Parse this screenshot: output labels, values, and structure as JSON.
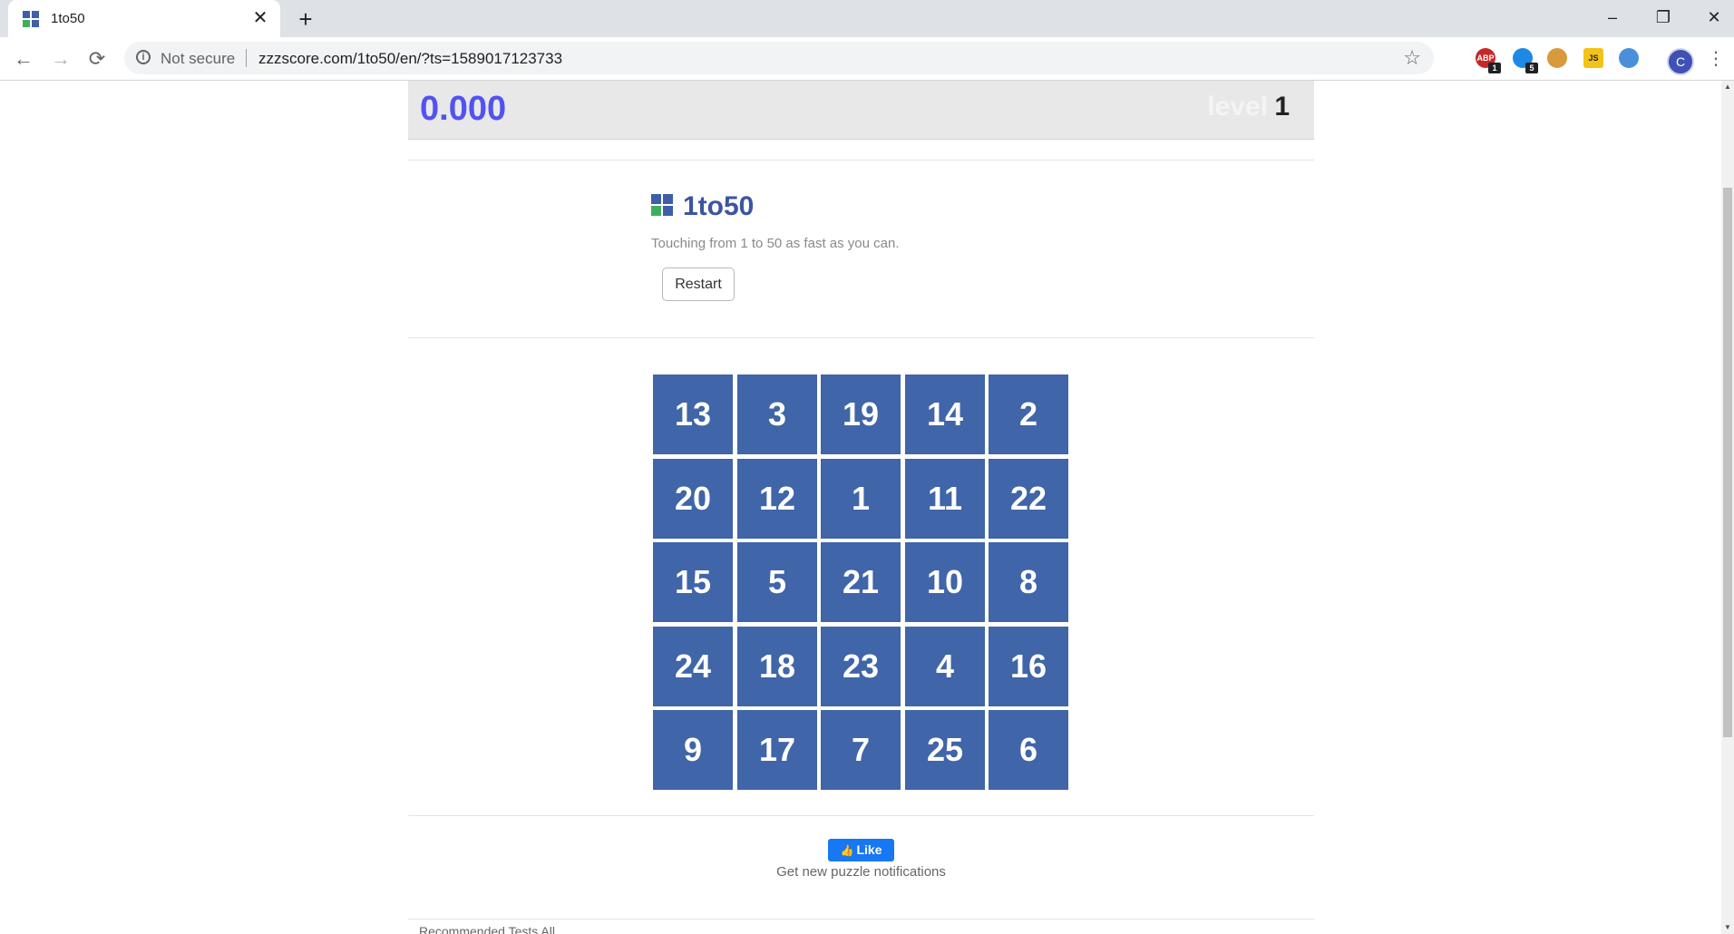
{
  "browser": {
    "tab_title": "1to50",
    "close_glyph": "✕",
    "new_tab_glyph": "+",
    "security_label": "Not secure",
    "url": "zzzscore.com/1to50/en/?ts=1589017123733",
    "profile_initial": "C",
    "extensions": [
      {
        "name": "adblock",
        "color": "#c62828",
        "label": "ABP",
        "badge": "1"
      },
      {
        "name": "extension-blue",
        "color": "#1e88e5",
        "label": "",
        "badge": "5"
      },
      {
        "name": "cookie",
        "color": "#d89a3a",
        "label": "",
        "badge": ""
      },
      {
        "name": "javascript",
        "color": "#f2c318",
        "label": "JS",
        "badge": ""
      },
      {
        "name": "extension-round",
        "color": "#4a90d9",
        "label": "",
        "badge": ""
      }
    ]
  },
  "game": {
    "timer": "0.000",
    "level_label": "level",
    "level_value": "1",
    "title": "1to50",
    "subtitle": "Touching from 1 to 50 as fast as you can.",
    "restart_label": "Restart",
    "grid": [
      [
        "13",
        "3",
        "19",
        "14",
        "2"
      ],
      [
        "20",
        "12",
        "1",
        "11",
        "22"
      ],
      [
        "15",
        "5",
        "21",
        "10",
        "8"
      ],
      [
        "24",
        "18",
        "23",
        "4",
        "16"
      ],
      [
        "9",
        "17",
        "7",
        "25",
        "6"
      ]
    ],
    "cell_color": "#4065a8",
    "accent_color": "#5252f2"
  },
  "social": {
    "like_label": "Like",
    "notify_text": "Get new puzzle notifications"
  },
  "footer": {
    "text": "Recommended Tests All"
  }
}
